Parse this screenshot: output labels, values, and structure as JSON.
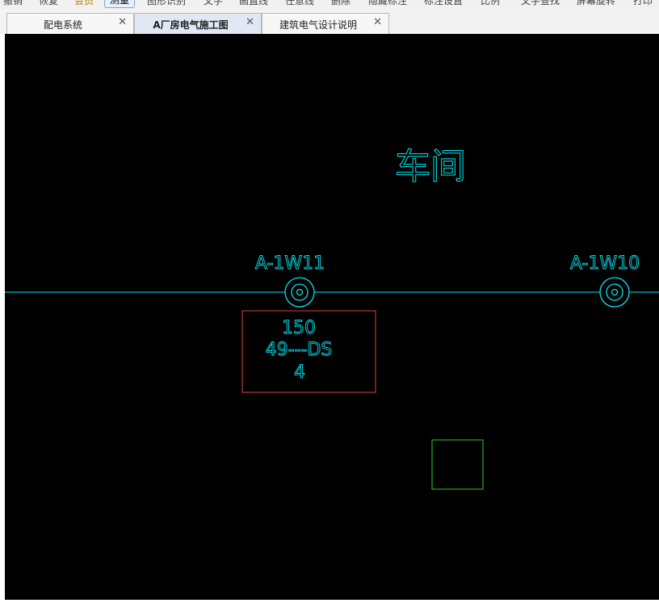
{
  "toolbar": {
    "items": [
      "撤销",
      "恢复",
      "会员",
      "测量",
      "图形识别",
      "文字",
      "画直线",
      "任意线",
      "删除",
      "隐藏标注",
      "标注设置",
      "比例",
      "文字查找",
      "屏幕旋转",
      "打印"
    ]
  },
  "tabs": [
    {
      "label": "配电系统",
      "active": false
    },
    {
      "label": "A厂房电气施工图",
      "active": true
    },
    {
      "label": "建筑电气设计说明",
      "active": false
    }
  ],
  "drawing": {
    "room_label": "车间",
    "fixture_left_label": "A-1W11",
    "fixture_right_label": "A-1W10",
    "annotation": {
      "line1": "150",
      "line2": "49---DS",
      "line3": "4"
    },
    "colors": {
      "cad_cyan": "#00e5ee",
      "box_red": "#e04040",
      "box_green": "#2ed12e",
      "canvas_bg": "#000000"
    }
  }
}
